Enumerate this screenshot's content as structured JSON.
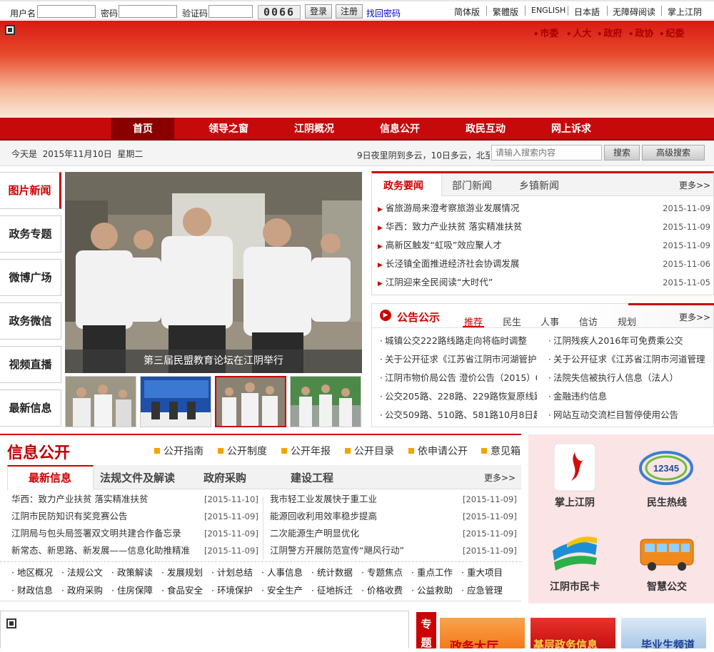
{
  "login": {
    "username_label": "用户名",
    "password_label": "密码",
    "captcha_label": "验证码",
    "captcha_code": "0066",
    "login_button": "登录",
    "register_button": "注册",
    "recover_link": "找回密码"
  },
  "languages": [
    "简体版",
    "繁體版",
    "ENGLISH",
    "日本語",
    "无障碍阅读",
    "掌上江阴"
  ],
  "top_links": [
    "市委",
    "人大",
    "政府",
    "政协",
    "纪委"
  ],
  "nav": [
    "首页",
    "领导之窗",
    "江阴概况",
    "信息公开",
    "政民互动",
    "网上诉求"
  ],
  "date_bar": {
    "date_text": "今天是  2015年11月10日  星期二",
    "weather_text": "9日夜里阴到多云，10日多云，北至",
    "search_placeholder": "请输入搜索内容",
    "search_button": "搜索",
    "advanced_button": "高级搜索"
  },
  "left_menu": [
    "图片新闻",
    "政务专题",
    "微博广场",
    "政务微信",
    "视频直播",
    "最新信息"
  ],
  "photo_caption": "第三届民盟教育论坛在江阴举行",
  "news": {
    "tabs": [
      "政务要闻",
      "部门新闻",
      "乡镇新闻"
    ],
    "more": "更多>>",
    "items": [
      {
        "title": "省旅游局来澄考察旅游业发展情况",
        "date": "2015-11-09"
      },
      {
        "title": "华西：致力产业扶贫 落实精准扶贫",
        "date": "2015-11-09"
      },
      {
        "title": "高新区触发“虹吸”效应聚人才",
        "date": "2015-11-09"
      },
      {
        "title": "长泾镇全面推进经济社会协调发展",
        "date": "2015-11-06"
      },
      {
        "title": "江阴迎来全民阅读“大时代”",
        "date": "2015-11-05"
      }
    ]
  },
  "announce": {
    "title": "公告公示",
    "tabs": [
      "推荐",
      "民生",
      "人事",
      "信访",
      "规划"
    ],
    "more": "更多>>",
    "items": [
      "城镇公交222路线路走向将临时调整",
      "江阴残疾人2016年可免费乘公交",
      "关于公开征求《江苏省江阴市河湖管护",
      "关于公开征求《江苏省江阴市河道管理",
      "江阴市物价局公告 澄价公告（2015）0",
      "法院失信被执行人信息（法人）",
      "公交205路、228路、229路恢复原线路",
      "金融违约信息",
      "公交509路、510路、581路10月8日起临",
      "网站互动交流栏目暂停使用公告"
    ]
  },
  "info": {
    "title": "信息公开",
    "sub_links": [
      "公开指南",
      "公开制度",
      "公开年报",
      "公开目录",
      "依申请公开",
      "意见箱"
    ],
    "tabs": [
      "最新信息",
      "法规文件及解读",
      "政府采购",
      "建设工程"
    ],
    "more": "更多>>",
    "left_items": [
      {
        "title": "华西：致力产业扶贫 落实精准扶贫",
        "date": "[2015-11-10]"
      },
      {
        "title": "江阴市民防知识有奖竞赛公告",
        "date": "[2015-11-09]"
      },
      {
        "title": "江阴局与包头局签署双文明共建合作备忘录",
        "date": "[2015-11-09]"
      },
      {
        "title": "新常态、新思路、新发展——信息化助推精准",
        "date": "[2015-11-09]"
      }
    ],
    "right_items": [
      {
        "title": "我市轻工业发展快于重工业",
        "date": "[2015-11-09]"
      },
      {
        "title": "能源回收利用效率稳步提高",
        "date": "[2015-11-09]"
      },
      {
        "title": "二次能源生产明显优化",
        "date": "[2015-11-09]"
      },
      {
        "title": "江阴警方开展防范宣传“飓风行动”",
        "date": "[2015-11-09]"
      }
    ],
    "categories_row1": [
      "地区概况",
      "法规公文",
      "政策解读",
      "发展规划",
      "计划总结",
      "人事信息",
      "统计数据",
      "专题焦点",
      "重点工作",
      "重大项目"
    ],
    "categories_row2": [
      "财政信息",
      "政府采购",
      "住房保障",
      "食品安全",
      "环境保护",
      "安全生产",
      "征地拆迁",
      "价格收费",
      "公益救助",
      "应急管理"
    ]
  },
  "services": [
    "掌上江阴",
    "民生热线",
    "江阴市民卡",
    "智慧公交"
  ],
  "services_hotline": "12345",
  "special": {
    "side_label": "专题",
    "banners": [
      "政务大厅",
      "基层政务信息",
      "毕业生频道"
    ]
  }
}
